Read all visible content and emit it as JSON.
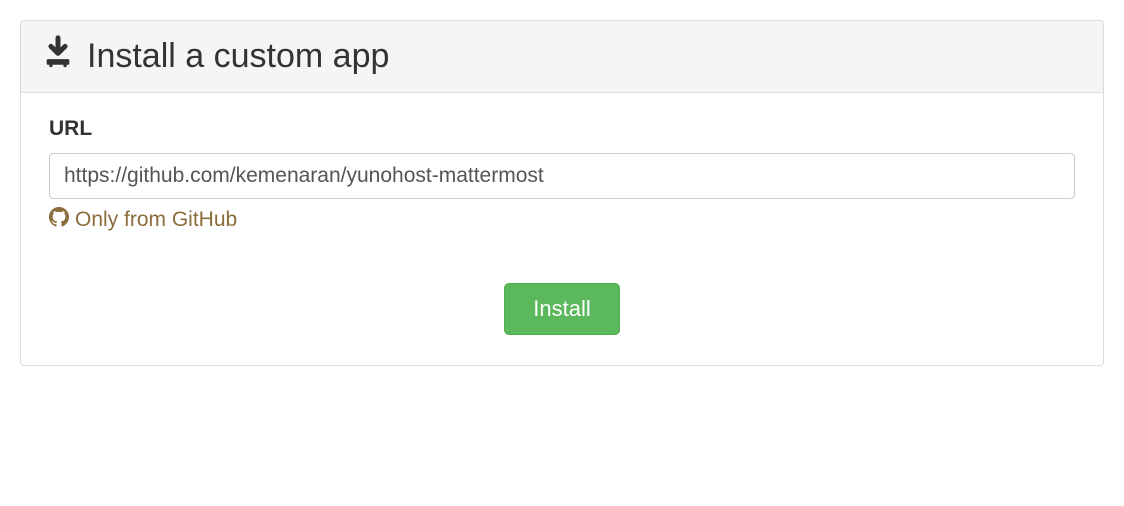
{
  "panel": {
    "title": "Install a custom app"
  },
  "form": {
    "url_label": "URL",
    "url_value": "https://github.com/kemenaran/yunohost-mattermost",
    "url_placeholder": "",
    "help_text": "Only from GitHub"
  },
  "actions": {
    "install_label": "Install"
  },
  "colors": {
    "header_bg": "#f5f5f5",
    "border": "#dddddd",
    "help_text": "#8a6d3b",
    "button_bg": "#5cb85c",
    "button_border": "#4cae4c"
  }
}
